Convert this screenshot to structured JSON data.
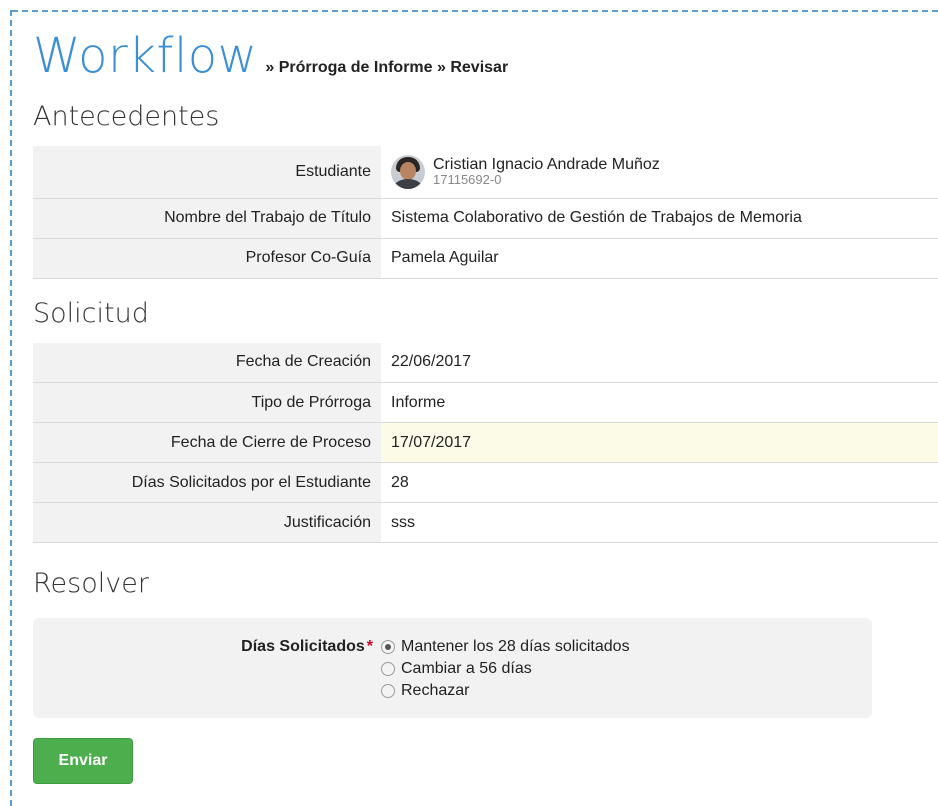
{
  "header": {
    "title": "Workflow",
    "breadcrumb": "» Prórroga de Informe » Revisar"
  },
  "antecedentes": {
    "heading": "Antecedentes",
    "student_label": "Estudiante",
    "student_name": "Cristian Ignacio Andrade Muñoz",
    "student_id": "17115692-0",
    "thesis_label": "Nombre del Trabajo de Título",
    "thesis_value": "Sistema Colaborativo de Gestión de Trabajos de Memoria",
    "cotutor_label": "Profesor Co-Guía",
    "cotutor_value": "Pamela Aguilar"
  },
  "solicitud": {
    "heading": "Solicitud",
    "rows": [
      {
        "label": "Fecha de Creación",
        "value": "22/06/2017"
      },
      {
        "label": "Tipo de Prórroga",
        "value": "Informe"
      },
      {
        "label": "Fecha de Cierre de Proceso",
        "value": "17/07/2017"
      },
      {
        "label": "Días Solicitados por el Estudiante",
        "value": "28"
      },
      {
        "label": "Justificación",
        "value": "sss"
      }
    ]
  },
  "resolver": {
    "heading": "Resolver",
    "field_label": "Días Solicitados",
    "required_mark": "*",
    "options": [
      {
        "label": "Mantener los 28 días solicitados",
        "checked": true
      },
      {
        "label": "Cambiar a 56 días",
        "checked": false
      },
      {
        "label": "Rechazar",
        "checked": false
      }
    ],
    "submit_label": "Enviar"
  },
  "colors": {
    "title": "#3a8fd6",
    "submit": "#4cae4c",
    "highlight_row": "#fcfbe8",
    "frame": "#5a9fd4"
  }
}
